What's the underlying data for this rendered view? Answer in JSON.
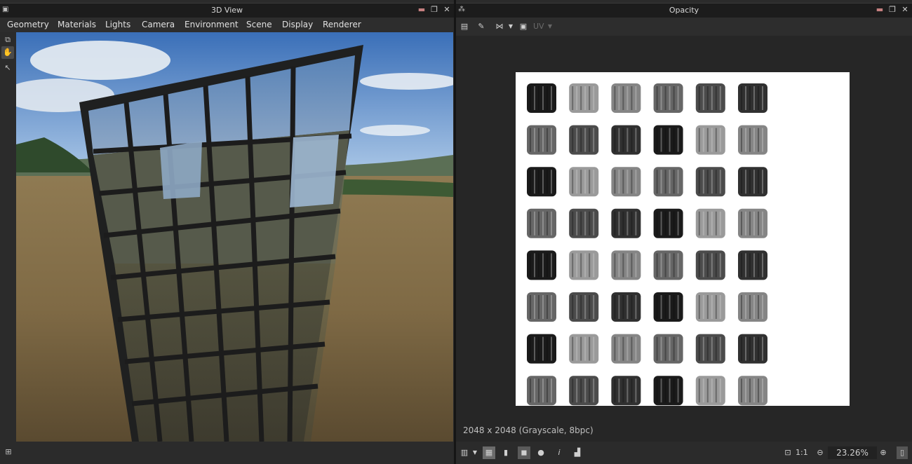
{
  "left_panel": {
    "title": "3D View",
    "menu": [
      "Geometry",
      "Materials",
      "Lights",
      "Camera",
      "Environment",
      "Scene",
      "Display",
      "Renderer"
    ]
  },
  "right_panel": {
    "title": "Opacity",
    "toolbar": {
      "uv_label": "UV"
    },
    "image_info": "2048 x 2048 (Grayscale, 8bpc)",
    "bottom": {
      "ratio_label": "1:1",
      "zoom": "23.26%",
      "info_label": "i"
    }
  },
  "colors": {
    "background": "#262626",
    "panel": "#2b2b2b",
    "titlebar": "#1c1c1c",
    "sheet": "#ffffff"
  },
  "icons": {
    "left_title": "cube-icon",
    "right_title": "nodes-icon",
    "title_buttons": [
      "pin-icon",
      "restore-icon",
      "close-icon"
    ],
    "left_tools": [
      "popout-icon",
      "hand-icon",
      "picker-icon"
    ],
    "texture_tools": [
      "copy-icon",
      "edit-icon",
      "share-icon",
      "snapshot-icon"
    ],
    "bottom_tools": [
      "channels-icon",
      "checker-icon",
      "gradient-icon",
      "rgb-icon",
      "color-icon",
      "info-icon",
      "histogram-icon",
      "fit-icon",
      "zoom-out-icon",
      "zoom-in-icon",
      "scroll-icon"
    ]
  }
}
